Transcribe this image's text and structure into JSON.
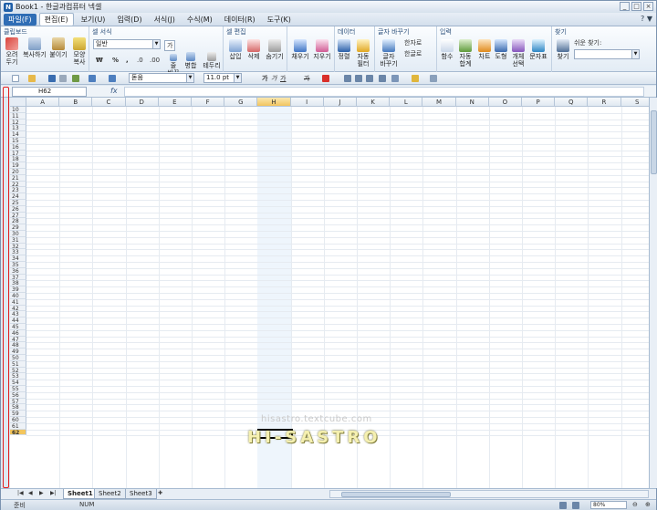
{
  "window": {
    "title": "Book1 - 한글과컴퓨터 넥셀",
    "logo": "N",
    "buttons": [
      "_",
      "□",
      "×"
    ]
  },
  "menu": {
    "items": [
      {
        "label": "파일(F)",
        "kind": "file"
      },
      {
        "label": "편집(E)",
        "kind": "active"
      },
      {
        "label": "보기(U)",
        "kind": ""
      },
      {
        "label": "입력(D)",
        "kind": ""
      },
      {
        "label": "서식(J)",
        "kind": ""
      },
      {
        "label": "수식(M)",
        "kind": ""
      },
      {
        "label": "데이터(R)",
        "kind": ""
      },
      {
        "label": "도구(K)",
        "kind": ""
      }
    ],
    "help": "?  ▼"
  },
  "ribbon": {
    "clipboard": {
      "title": "클립보드",
      "cut": "오려\n두기",
      "copy": "복사하기",
      "paste": "붙이기",
      "format": "모양\n복사"
    },
    "cellformat": {
      "title": "셀 서식",
      "format_value": "일반",
      "currency": "₩",
      "percent": "%",
      "comma": ",",
      "inc": ".0",
      "dec": ".00",
      "box_icon": "가",
      "merge": "병합",
      "wrap": "줄\n바꿈",
      "border": "테두리"
    },
    "celledit": {
      "title": "셀 편집",
      "insert": "삽입",
      "delete": "삭제",
      "hide": "숨기기"
    },
    "fill": {
      "fill": "채우기",
      "erase": "지우기"
    },
    "data": {
      "title": "데이터",
      "sort": "정렬",
      "filter": "자동\n필터"
    },
    "charconv": {
      "title": "글자 바꾸기",
      "hanja": "한자로",
      "hangul": "한글로",
      "change": "글자\n바꾸기"
    },
    "input": {
      "title": "입력",
      "func": "함수",
      "autosum": "자동\n합계",
      "chart": "차트",
      "shape": "도형",
      "object": "개체\n선택",
      "symbol": "문자표"
    },
    "find": {
      "title": "찾기",
      "find": "찾기",
      "label": "쉬운 찾기:"
    }
  },
  "toolbar2": {
    "font": "돋움",
    "size": "11.0",
    "unit": "pt",
    "bold": "가",
    "italic": "가",
    "underline": "가",
    "strike": "가"
  },
  "formula": {
    "namebox": "H62",
    "fx": "fx",
    "value": ""
  },
  "grid": {
    "columns": [
      "A",
      "B",
      "C",
      "D",
      "E",
      "F",
      "G",
      "H",
      "I",
      "J",
      "K",
      "L",
      "M",
      "N",
      "O",
      "P",
      "Q",
      "R",
      "S"
    ],
    "rows": [
      10,
      11,
      12,
      13,
      14,
      15,
      16,
      17,
      18,
      19,
      20,
      21,
      22,
      23,
      24,
      25,
      26,
      27,
      28,
      29,
      30,
      31,
      32,
      33,
      34,
      35,
      36,
      37,
      38,
      39,
      40,
      41,
      42,
      43,
      44,
      45,
      46,
      47,
      48,
      49,
      50,
      51,
      52,
      53,
      54,
      55,
      56,
      57,
      58,
      59,
      60,
      61,
      62
    ],
    "selected_column": "H",
    "selected_row": 62
  },
  "sheets": {
    "tabs": [
      "Sheet1",
      "Sheet2",
      "Sheet3"
    ],
    "active": "Sheet1"
  },
  "status": {
    "ready": "준비",
    "num": "NUM",
    "zoom": "80%"
  },
  "watermark": {
    "url": "hisastro.textcube.com",
    "brand": "HI-SASTRO"
  }
}
